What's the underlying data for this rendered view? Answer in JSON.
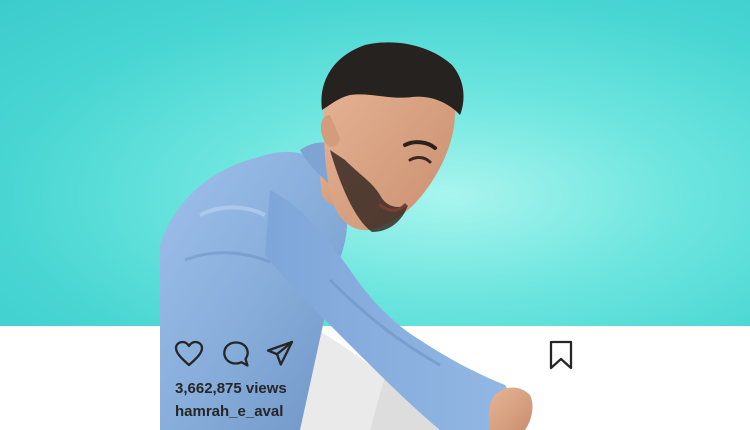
{
  "post": {
    "views_text": "3,662,875 views",
    "username": "hamrah_e_aval"
  },
  "icons": {
    "like": "heart-icon",
    "comment": "comment-icon",
    "share": "share-icon",
    "save": "bookmark-icon"
  },
  "colors": {
    "background_top": "#49d6d3",
    "shirt": "#8bb3e0",
    "icon_stroke": "#262626",
    "text": "#262626"
  }
}
